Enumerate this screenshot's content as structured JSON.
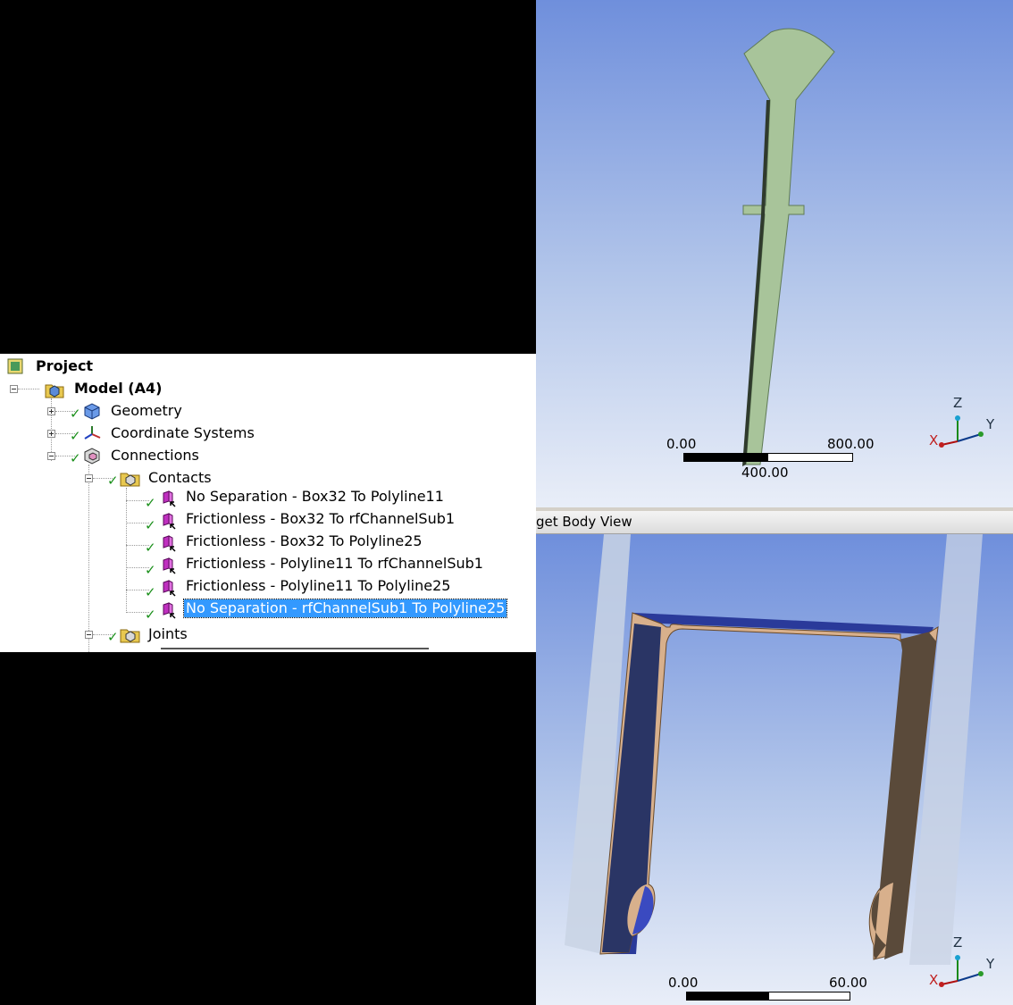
{
  "tree": {
    "root": {
      "label": "Project",
      "icon": "project-icon"
    },
    "model": {
      "label": "Model (A4)",
      "icon": "model-icon"
    },
    "geometry": {
      "label": "Geometry",
      "icon": "geometry-icon"
    },
    "coordinate_systems": {
      "label": "Coordinate Systems",
      "icon": "coordinate-systems-icon"
    },
    "connections": {
      "label": "Connections",
      "icon": "connections-icon"
    },
    "contacts": {
      "label": "Contacts",
      "icon": "contacts-folder-icon"
    },
    "contact_items": [
      {
        "label": "No Separation - Box32 To Polyline11",
        "selected": false
      },
      {
        "label": "Frictionless - Box32 To rfChannelSub1",
        "selected": false
      },
      {
        "label": "Frictionless - Box32 To Polyline25",
        "selected": false
      },
      {
        "label": "Frictionless - Polyline11 To rfChannelSub1",
        "selected": false
      },
      {
        "label": "Frictionless - Polyline11 To Polyline25",
        "selected": false
      },
      {
        "label": "No Separation - rfChannelSub1 To Polyline25",
        "selected": true
      }
    ],
    "joints": {
      "label": "Joints",
      "icon": "joints-folder-icon"
    }
  },
  "top_view": {
    "scale": {
      "left": "0.00",
      "mid": "400.00",
      "right": "800.00"
    },
    "triad": {
      "x": "X",
      "y": "Y",
      "z": "Z"
    }
  },
  "bottom_view": {
    "title": "get Body View",
    "scale": {
      "left": "0.00",
      "right": "60.00"
    },
    "triad": {
      "x": "X",
      "y": "Y",
      "z": "Z"
    }
  },
  "colors": {
    "selection": "#3399ff",
    "viewport_top": "#6f8fdc",
    "viewport_bottom": "#e9eef8",
    "part_green": "#a8c49a",
    "contact_blue": "#2a3a9a",
    "contact_tan": "#d8b08c"
  }
}
